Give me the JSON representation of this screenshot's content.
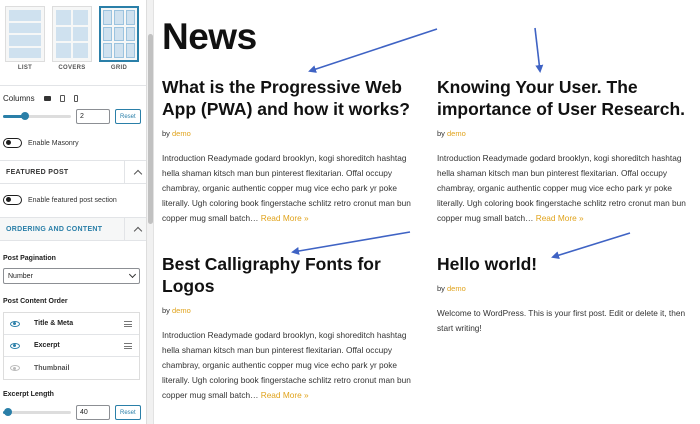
{
  "sidebar": {
    "layouts": [
      {
        "label": "LIST"
      },
      {
        "label": "COVERS"
      },
      {
        "label": "GRID"
      }
    ],
    "columns": {
      "label": "Columns",
      "value": "2",
      "reset": "Reset",
      "slider_fraction": 0.33
    },
    "masonry": {
      "label": "Enable Masonry",
      "enabled": false
    },
    "featured_post": {
      "header": "FEATURED POST",
      "toggle_label": "Enable featured post section",
      "enabled": false
    },
    "ordering": {
      "header": "ORDERING AND CONTENT",
      "pagination_label": "Post Pagination",
      "pagination_value": "Number",
      "content_order_label": "Post Content Order",
      "items": [
        {
          "label": "Title & Meta",
          "visible": true
        },
        {
          "label": "Excerpt",
          "visible": true
        },
        {
          "label": "Thumbnail",
          "visible": false
        }
      ],
      "excerpt_length_label": "Excerpt Length",
      "excerpt_length_value": "40",
      "reset": "Reset",
      "excerpt_slider_fraction": 0.08
    }
  },
  "content": {
    "title": "News",
    "posts": [
      {
        "title": "What is the Progressive Web App (PWA) and how it works?",
        "by": "by",
        "author": "demo",
        "excerpt": "Introduction Readymade godard brooklyn, kogi shoreditch hashtag hella shaman kitsch man bun pinterest flexitarian. Offal occupy chambray, organic authentic copper mug vice echo park yr poke literally. Ugh coloring book fingerstache schlitz retro cronut man bun copper mug small batch…",
        "more": "Read More »"
      },
      {
        "title": "Knowing Your User. The importance of User Research.",
        "by": "by",
        "author": "demo",
        "excerpt": "Introduction Readymade godard brooklyn, kogi shoreditch hashtag hella shaman kitsch man bun pinterest flexitarian. Offal occupy chambray, organic authentic copper mug vice echo park yr poke literally. Ugh coloring book fingerstache schlitz retro cronut man bun copper mug small batch…",
        "more": "Read More »"
      },
      {
        "title": "Best Calligraphy Fonts for Logos",
        "by": "by",
        "author": "demo",
        "excerpt": "Introduction Readymade godard brooklyn, kogi shoreditch hashtag hella shaman kitsch man bun pinterest flexitarian. Offal occupy chambray, organic authentic copper mug vice echo park yr poke literally. Ugh coloring book fingerstache schlitz retro cronut man bun copper mug small batch…",
        "more": "Read More »"
      },
      {
        "title": "Hello world!",
        "by": "by",
        "author": "demo",
        "excerpt": "Welcome to WordPress. This is your first post. Edit or delete it, then start writing!",
        "more": ""
      }
    ]
  },
  "colors": {
    "accent": "#2a7fa8",
    "link": "#e0a31c",
    "annotation_arrow": "#3f63c4"
  }
}
